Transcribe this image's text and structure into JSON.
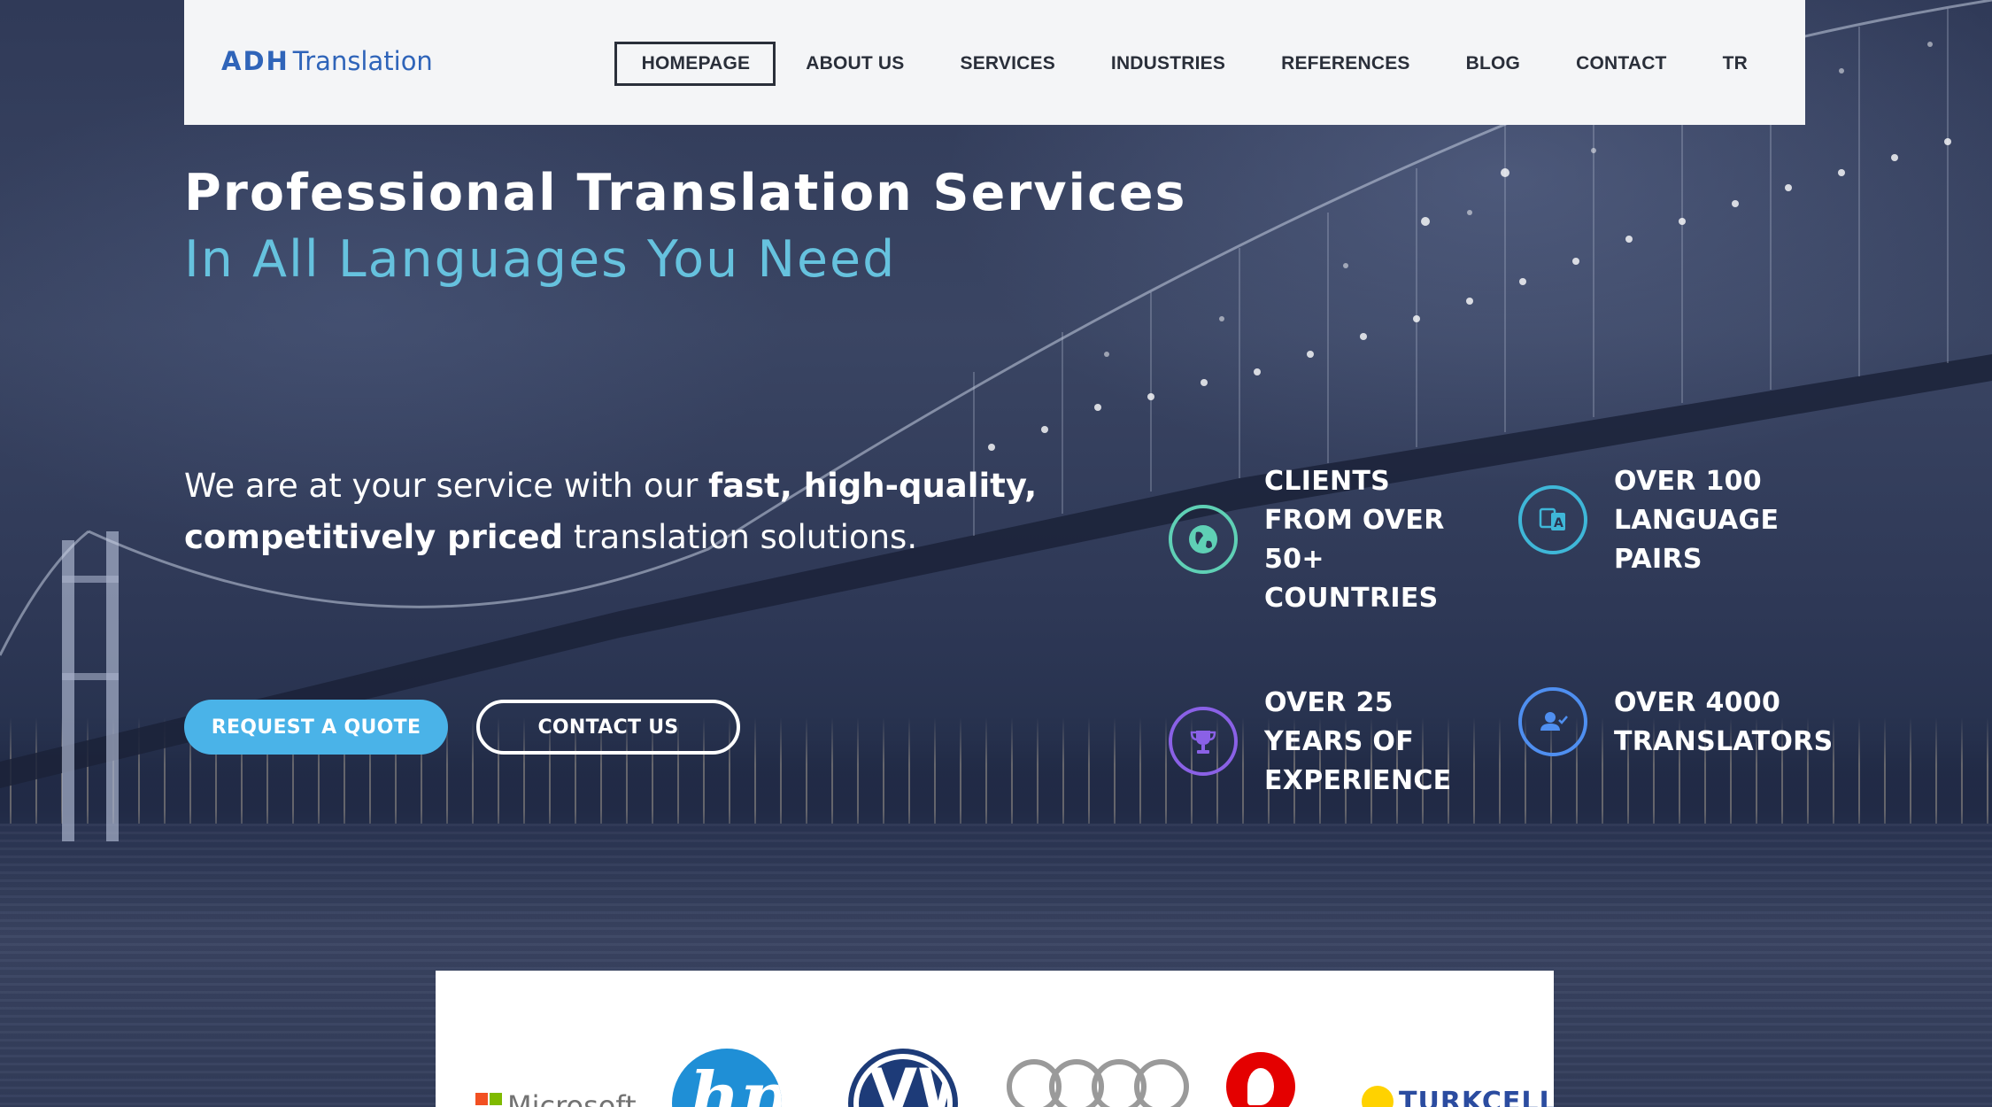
{
  "header": {
    "logo_bold": "ADH",
    "logo_light": "Translation",
    "nav": [
      {
        "label": "HOMEPAGE",
        "active": true
      },
      {
        "label": "ABOUT US",
        "active": false
      },
      {
        "label": "SERVICES",
        "active": false
      },
      {
        "label": "INDUSTRIES",
        "active": false
      },
      {
        "label": "REFERENCES",
        "active": false
      },
      {
        "label": "BLOG",
        "active": false
      },
      {
        "label": "CONTACT",
        "active": false
      },
      {
        "label": "TR",
        "active": false
      }
    ]
  },
  "hero": {
    "headline": "Professional Translation Services",
    "subheadline": "In All Languages You Need",
    "intro": {
      "part1": "We are at your service with our ",
      "bold1": "fast, high-quality,",
      "bold2": "competitively priced",
      "part2": " translation solutions."
    },
    "buttons": {
      "quote": "REQUEST A QUOTE",
      "contact": "CONTACT US"
    }
  },
  "stats": [
    {
      "text": "CLIENTS FROM OVER 50+ COUNTRIES",
      "icon": "globe-icon",
      "color": "#5fd0b5"
    },
    {
      "text": "OVER 100 LANGUAGE PAIRS",
      "icon": "translate-icon",
      "color": "#3fb7d8"
    },
    {
      "text": "OVER 25 YEARS OF EXPERIENCE",
      "icon": "trophy-icon",
      "color": "#8a61e6"
    },
    {
      "text": "OVER 4000 TRANSLATORS",
      "icon": "user-check-icon",
      "color": "#4f8ff0"
    }
  ],
  "clients": {
    "microsoft": "Microsoft",
    "hp": "hp",
    "vw": "VW",
    "turkcell": "TURKCELL"
  },
  "colors": {
    "accent": "#4ab3e8",
    "subheadline": "#66c2de",
    "logo": "#2f64b9"
  }
}
